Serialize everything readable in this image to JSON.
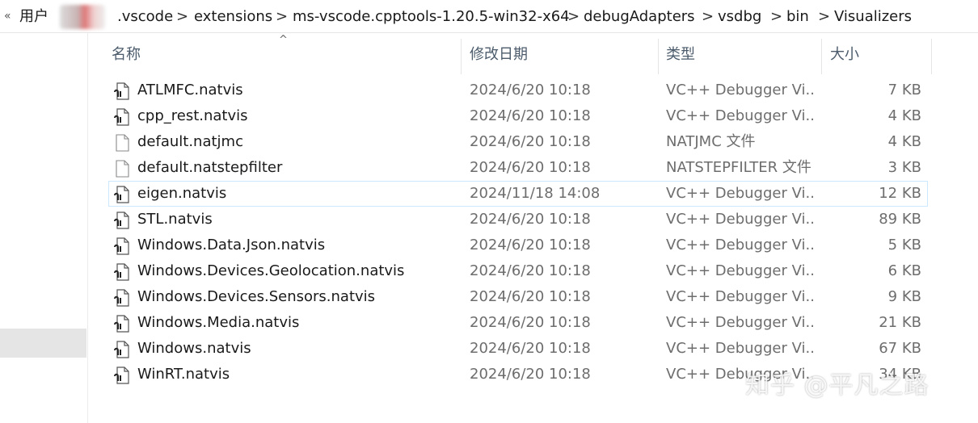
{
  "addressbar": {
    "back_glyph": "«",
    "crumbs": [
      ".vscode",
      "extensions",
      "ms-vscode.cpptools-1.20.5-win32-x64",
      "debugAdapters",
      "vsdbg",
      "bin",
      "Visualizers"
    ],
    "root_label": "用户",
    "separator": ">"
  },
  "headers": {
    "name": "名称",
    "date": "修改日期",
    "type": "类型",
    "size": "大小",
    "sort_glyph": "^"
  },
  "files": [
    {
      "name": "ATLMFC.natvis",
      "date": "2024/6/20 10:18",
      "type": "VC++ Debugger Vi...",
      "size": "7 KB",
      "icon": "natvis-file-icon"
    },
    {
      "name": "cpp_rest.natvis",
      "date": "2024/6/20 10:18",
      "type": "VC++ Debugger Vi...",
      "size": "4 KB",
      "icon": "natvis-file-icon"
    },
    {
      "name": "default.natjmc",
      "date": "2024/6/20 10:18",
      "type": "NATJMC 文件",
      "size": "4 KB",
      "icon": "blank-file-icon"
    },
    {
      "name": "default.natstepfilter",
      "date": "2024/6/20 10:18",
      "type": "NATSTEPFILTER 文件",
      "size": "3 KB",
      "icon": "blank-file-icon"
    },
    {
      "name": "eigen.natvis",
      "date": "2024/11/18 14:08",
      "type": "VC++ Debugger Vi...",
      "size": "12 KB",
      "icon": "natvis-file-icon"
    },
    {
      "name": "STL.natvis",
      "date": "2024/6/20 10:18",
      "type": "VC++ Debugger Vi...",
      "size": "89 KB",
      "icon": "natvis-file-icon"
    },
    {
      "name": "Windows.Data.Json.natvis",
      "date": "2024/6/20 10:18",
      "type": "VC++ Debugger Vi...",
      "size": "5 KB",
      "icon": "natvis-file-icon"
    },
    {
      "name": "Windows.Devices.Geolocation.natvis",
      "date": "2024/6/20 10:18",
      "type": "VC++ Debugger Vi...",
      "size": "6 KB",
      "icon": "natvis-file-icon"
    },
    {
      "name": "Windows.Devices.Sensors.natvis",
      "date": "2024/6/20 10:18",
      "type": "VC++ Debugger Vi...",
      "size": "9 KB",
      "icon": "natvis-file-icon"
    },
    {
      "name": "Windows.Media.natvis",
      "date": "2024/6/20 10:18",
      "type": "VC++ Debugger Vi...",
      "size": "21 KB",
      "icon": "natvis-file-icon"
    },
    {
      "name": "Windows.natvis",
      "date": "2024/6/20 10:18",
      "type": "VC++ Debugger Vi...",
      "size": "67 KB",
      "icon": "natvis-file-icon"
    },
    {
      "name": "WinRT.natvis",
      "date": "2024/6/20 10:18",
      "type": "VC++ Debugger Vi...",
      "size": "34 KB",
      "icon": "natvis-file-icon"
    }
  ],
  "selected_index": 4,
  "watermark": "知乎 @平凡之路",
  "colors": {
    "selection_border": "#cce8ff",
    "header_text": "#4b5b6b",
    "secondary_text": "#6d6d6d"
  }
}
